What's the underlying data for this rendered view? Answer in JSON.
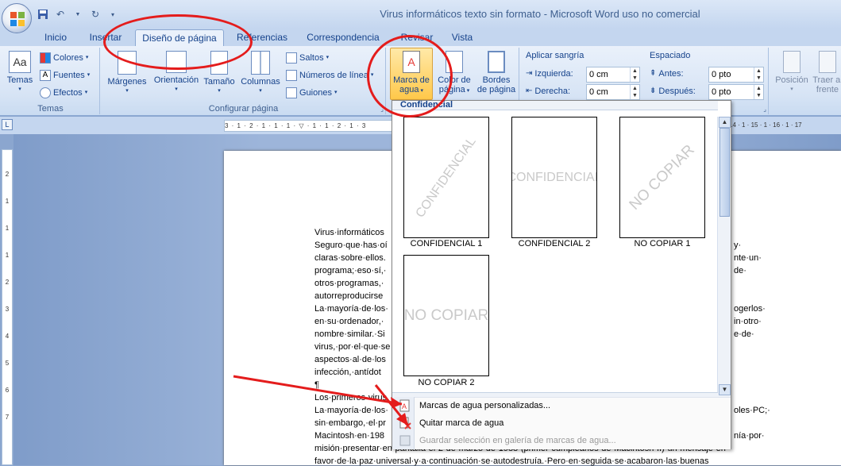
{
  "window": {
    "title": "Virus informáticos texto sin formato - Microsoft Word uso no comercial"
  },
  "tabs": [
    {
      "label": "Inicio"
    },
    {
      "label": "Insertar"
    },
    {
      "label": "Diseño de página"
    },
    {
      "label": "Referencias"
    },
    {
      "label": "Correspondencia"
    },
    {
      "label": "Revisar"
    },
    {
      "label": "Vista"
    }
  ],
  "ribbon": {
    "temas": {
      "label": "Temas",
      "themes_btn": "Temas",
      "colores": "Colores",
      "fuentes": "Fuentes",
      "efectos": "Efectos"
    },
    "configurar": {
      "label": "Configurar página",
      "margenes": "Márgenes",
      "orientacion": "Orientación",
      "tamano": "Tamaño",
      "columnas": "Columnas",
      "saltos": "Saltos",
      "numeros": "Números de línea",
      "guiones": "Guiones"
    },
    "fondo": {
      "marca_l1": "Marca de",
      "marca_l2": "agua",
      "color_l1": "Color de",
      "color_l2": "página",
      "bordes_l1": "Bordes",
      "bordes_l2": "de página"
    },
    "parrafo": {
      "sangria_title": "Aplicar sangría",
      "izquierda": "Izquierda:",
      "izquierda_val": "0 cm",
      "derecha": "Derecha:",
      "derecha_val": "0 cm",
      "espaciado_title": "Espaciado",
      "antes": "Antes:",
      "antes_val": "0 pto",
      "despues": "Después:",
      "despues_val": "0 pto"
    },
    "organizar": {
      "posicion": "Posición",
      "traer_l1": "Traer al",
      "traer_l2": "frente"
    }
  },
  "ruler": {
    "h_left": "3 · 1 · 2 · 1 · 1 · 1 · ▽ · 1 · 1 · 2 · 1 · 3",
    "h_right": "14 · 1 · 15 · 1 · 16 · 1 · 17",
    "v_marks": [
      "2",
      "1",
      "1",
      "1",
      "2",
      "3",
      "4",
      "5",
      "6",
      "7"
    ]
  },
  "document": {
    "lines": [
      "Virus·informáticos",
      "Seguro·que·has·oí",
      "claras·sobre·ellos.",
      "programa;·eso·sí,·",
      "otros·programas,·",
      "autorreproducirse",
      "La·mayoría·de·los·",
      "en·su·ordenador,·",
      "nombre·similar.·Si",
      "virus,·por·el·que·se",
      "aspectos·al·de·los",
      "infección,·antídot",
      "¶",
      "Los·primeros·virus",
      "La·mayoría·de·los·",
      "sin·embargo,·el·pr",
      "Macintosh·en·198",
      "misión·presentar·en·pantalla·el·2·de·marzo·de·1988·(primer·cumpleaños·de·Macintosh·II)·un·mensaje·en·",
      "favor·de·la·paz·universal·y·a·continuación·se·autodestruía.·Pero·en·seguida·se·acabaron·las·buenas"
    ],
    "right_fragments": [
      "y·",
      "nte·un·",
      "de·",
      "ogerlos·",
      "in·otro·",
      "e·de·",
      "oles·PC;·",
      "nía·por·"
    ]
  },
  "gallery": {
    "section": "Confidencial",
    "items": [
      {
        "label": "CONFIDENCIAL 1",
        "watermark": "CONFIDENCIAL"
      },
      {
        "label": "CONFIDENCIAL 2",
        "watermark": "CONFIDENCIAL"
      },
      {
        "label": "NO COPIAR 1",
        "watermark": "NO COPIAR"
      },
      {
        "label": "NO COPIAR 2",
        "watermark": "NO COPIAR"
      }
    ],
    "menu": {
      "custom": "Marcas de agua personalizadas...",
      "remove": "Quitar marca de agua",
      "save": "Guardar selección en galería de marcas de agua..."
    }
  },
  "colors": {
    "annotation": "#e41c1c",
    "ribbon_text": "#15428b"
  }
}
